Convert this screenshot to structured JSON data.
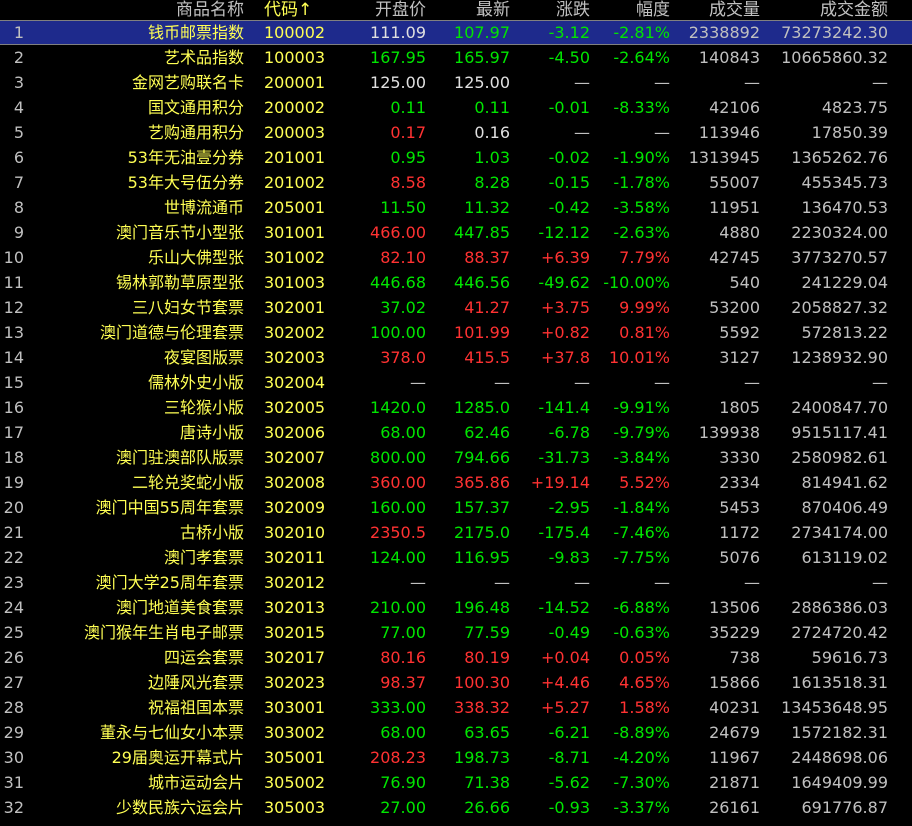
{
  "headers": {
    "name": "商品名称",
    "code": "代码",
    "sort_arrow": "↑",
    "open": "开盘价",
    "last": "最新",
    "change": "涨跌",
    "pct": "幅度",
    "volume": "成交量",
    "amount": "成交金额"
  },
  "colors": {
    "up": "#ff3232",
    "down": "#00e600",
    "label": "#ffff54",
    "text": "#c0c0c0",
    "selected_bg": "#1e2a8c"
  },
  "selected_row": 1,
  "rows": [
    {
      "idx": "1",
      "name": "钱币邮票指数",
      "code": "100002",
      "open": "111.09",
      "last": "107.97",
      "chg": "-3.12",
      "pct": "-2.81%",
      "vol": "2338892",
      "amt": "73273242.30",
      "open_c": "flat",
      "last_c": "down",
      "chg_c": "down"
    },
    {
      "idx": "2",
      "name": "艺术品指数",
      "code": "100003",
      "open": "167.95",
      "last": "165.97",
      "chg": "-4.50",
      "pct": "-2.64%",
      "vol": "140843",
      "amt": "10665860.32",
      "open_c": "down",
      "last_c": "down",
      "chg_c": "down"
    },
    {
      "idx": "3",
      "name": "金网艺购联名卡",
      "code": "200001",
      "open": "125.00",
      "last": "125.00",
      "chg": "—",
      "pct": "—",
      "vol": "—",
      "amt": "—",
      "open_c": "flat",
      "last_c": "flat",
      "chg_c": "dash"
    },
    {
      "idx": "4",
      "name": "国文通用积分",
      "code": "200002",
      "open": "0.11",
      "last": "0.11",
      "chg": "-0.01",
      "pct": "-8.33%",
      "vol": "42106",
      "amt": "4823.75",
      "open_c": "down",
      "last_c": "down",
      "chg_c": "down"
    },
    {
      "idx": "5",
      "name": "艺购通用积分",
      "code": "200003",
      "open": "0.17",
      "last": "0.16",
      "chg": "—",
      "pct": "—",
      "vol": "113946",
      "amt": "17850.39",
      "open_c": "up",
      "last_c": "flat",
      "chg_c": "dash"
    },
    {
      "idx": "6",
      "name": "53年无油壹分券",
      "code": "201001",
      "open": "0.95",
      "last": "1.03",
      "chg": "-0.02",
      "pct": "-1.90%",
      "vol": "1313945",
      "amt": "1365262.76",
      "open_c": "down",
      "last_c": "down",
      "chg_c": "down"
    },
    {
      "idx": "7",
      "name": "53年大号伍分券",
      "code": "201002",
      "open": "8.58",
      "last": "8.28",
      "chg": "-0.15",
      "pct": "-1.78%",
      "vol": "55007",
      "amt": "455345.73",
      "open_c": "up",
      "last_c": "down",
      "chg_c": "down"
    },
    {
      "idx": "8",
      "name": "世博流通币",
      "code": "205001",
      "open": "11.50",
      "last": "11.32",
      "chg": "-0.42",
      "pct": "-3.58%",
      "vol": "11951",
      "amt": "136470.53",
      "open_c": "down",
      "last_c": "down",
      "chg_c": "down"
    },
    {
      "idx": "9",
      "name": "澳门音乐节小型张",
      "code": "301001",
      "open": "466.00",
      "last": "447.85",
      "chg": "-12.12",
      "pct": "-2.63%",
      "vol": "4880",
      "amt": "2230324.00",
      "open_c": "up",
      "last_c": "down",
      "chg_c": "down"
    },
    {
      "idx": "10",
      "name": "乐山大佛型张",
      "code": "301002",
      "open": "82.10",
      "last": "88.37",
      "chg": "+6.39",
      "pct": "7.79%",
      "vol": "42745",
      "amt": "3773270.57",
      "open_c": "up",
      "last_c": "up",
      "chg_c": "up"
    },
    {
      "idx": "11",
      "name": "锡林郭勒草原型张",
      "code": "301003",
      "open": "446.68",
      "last": "446.56",
      "chg": "-49.62",
      "pct": "-10.00%",
      "vol": "540",
      "amt": "241229.04",
      "open_c": "down",
      "last_c": "down",
      "chg_c": "down"
    },
    {
      "idx": "12",
      "name": "三八妇女节套票",
      "code": "302001",
      "open": "37.02",
      "last": "41.27",
      "chg": "+3.75",
      "pct": "9.99%",
      "vol": "53200",
      "amt": "2058827.32",
      "open_c": "down",
      "last_c": "up",
      "chg_c": "up"
    },
    {
      "idx": "13",
      "name": "澳门道德与伦理套票",
      "code": "302002",
      "open": "100.00",
      "last": "101.99",
      "chg": "+0.82",
      "pct": "0.81%",
      "vol": "5592",
      "amt": "572813.22",
      "open_c": "down",
      "last_c": "up",
      "chg_c": "up"
    },
    {
      "idx": "14",
      "name": "夜宴图版票",
      "code": "302003",
      "open": "378.0",
      "last": "415.5",
      "chg": "+37.8",
      "pct": "10.01%",
      "vol": "3127",
      "amt": "1238932.90",
      "open_c": "up",
      "last_c": "up",
      "chg_c": "up"
    },
    {
      "idx": "15",
      "name": "儒林外史小版",
      "code": "302004",
      "open": "—",
      "last": "—",
      "chg": "—",
      "pct": "—",
      "vol": "—",
      "amt": "—",
      "open_c": "dash",
      "last_c": "dash",
      "chg_c": "dash"
    },
    {
      "idx": "16",
      "name": "三轮猴小版",
      "code": "302005",
      "open": "1420.0",
      "last": "1285.0",
      "chg": "-141.4",
      "pct": "-9.91%",
      "vol": "1805",
      "amt": "2400847.70",
      "open_c": "down",
      "last_c": "down",
      "chg_c": "down"
    },
    {
      "idx": "17",
      "name": "唐诗小版",
      "code": "302006",
      "open": "68.00",
      "last": "62.46",
      "chg": "-6.78",
      "pct": "-9.79%",
      "vol": "139938",
      "amt": "9515117.41",
      "open_c": "down",
      "last_c": "down",
      "chg_c": "down"
    },
    {
      "idx": "18",
      "name": "澳门驻澳部队版票",
      "code": "302007",
      "open": "800.00",
      "last": "794.66",
      "chg": "-31.73",
      "pct": "-3.84%",
      "vol": "3330",
      "amt": "2580982.61",
      "open_c": "down",
      "last_c": "down",
      "chg_c": "down"
    },
    {
      "idx": "19",
      "name": "二轮兑奖蛇小版",
      "code": "302008",
      "open": "360.00",
      "last": "365.86",
      "chg": "+19.14",
      "pct": "5.52%",
      "vol": "2334",
      "amt": "814941.62",
      "open_c": "up",
      "last_c": "up",
      "chg_c": "up"
    },
    {
      "idx": "20",
      "name": "澳门中国55周年套票",
      "code": "302009",
      "open": "160.00",
      "last": "157.37",
      "chg": "-2.95",
      "pct": "-1.84%",
      "vol": "5453",
      "amt": "870406.49",
      "open_c": "down",
      "last_c": "down",
      "chg_c": "down"
    },
    {
      "idx": "21",
      "name": "古桥小版",
      "code": "302010",
      "open": "2350.5",
      "last": "2175.0",
      "chg": "-175.4",
      "pct": "-7.46%",
      "vol": "1172",
      "amt": "2734174.00",
      "open_c": "up",
      "last_c": "down",
      "chg_c": "down"
    },
    {
      "idx": "22",
      "name": "澳门孝套票",
      "code": "302011",
      "open": "124.00",
      "last": "116.95",
      "chg": "-9.83",
      "pct": "-7.75%",
      "vol": "5076",
      "amt": "613119.02",
      "open_c": "down",
      "last_c": "down",
      "chg_c": "down"
    },
    {
      "idx": "23",
      "name": "澳门大学25周年套票",
      "code": "302012",
      "open": "—",
      "last": "—",
      "chg": "—",
      "pct": "—",
      "vol": "—",
      "amt": "—",
      "open_c": "dash",
      "last_c": "dash",
      "chg_c": "dash"
    },
    {
      "idx": "24",
      "name": "澳门地道美食套票",
      "code": "302013",
      "open": "210.00",
      "last": "196.48",
      "chg": "-14.52",
      "pct": "-6.88%",
      "vol": "13506",
      "amt": "2886386.03",
      "open_c": "down",
      "last_c": "down",
      "chg_c": "down"
    },
    {
      "idx": "25",
      "name": "澳门猴年生肖电子邮票",
      "code": "302015",
      "open": "77.00",
      "last": "77.59",
      "chg": "-0.49",
      "pct": "-0.63%",
      "vol": "35229",
      "amt": "2724720.42",
      "open_c": "down",
      "last_c": "down",
      "chg_c": "down"
    },
    {
      "idx": "26",
      "name": "四运会套票",
      "code": "302017",
      "open": "80.16",
      "last": "80.19",
      "chg": "+0.04",
      "pct": "0.05%",
      "vol": "738",
      "amt": "59616.73",
      "open_c": "up",
      "last_c": "up",
      "chg_c": "up"
    },
    {
      "idx": "27",
      "name": "边陲风光套票",
      "code": "302023",
      "open": "98.37",
      "last": "100.30",
      "chg": "+4.46",
      "pct": "4.65%",
      "vol": "15866",
      "amt": "1613518.31",
      "open_c": "up",
      "last_c": "up",
      "chg_c": "up"
    },
    {
      "idx": "28",
      "name": "祝福祖国本票",
      "code": "303001",
      "open": "333.00",
      "last": "338.32",
      "chg": "+5.27",
      "pct": "1.58%",
      "vol": "40231",
      "amt": "13453648.95",
      "open_c": "down",
      "last_c": "up",
      "chg_c": "up"
    },
    {
      "idx": "29",
      "name": "董永与七仙女小本票",
      "code": "303002",
      "open": "68.00",
      "last": "63.65",
      "chg": "-6.21",
      "pct": "-8.89%",
      "vol": "24679",
      "amt": "1572182.31",
      "open_c": "down",
      "last_c": "down",
      "chg_c": "down"
    },
    {
      "idx": "30",
      "name": "29届奥运开幕式片",
      "code": "305001",
      "open": "208.23",
      "last": "198.73",
      "chg": "-8.71",
      "pct": "-4.20%",
      "vol": "11967",
      "amt": "2448698.06",
      "open_c": "up",
      "last_c": "down",
      "chg_c": "down"
    },
    {
      "idx": "31",
      "name": "城市运动会片",
      "code": "305002",
      "open": "76.90",
      "last": "71.38",
      "chg": "-5.62",
      "pct": "-7.30%",
      "vol": "21871",
      "amt": "1649409.99",
      "open_c": "down",
      "last_c": "down",
      "chg_c": "down"
    },
    {
      "idx": "32",
      "name": "少数民族六运会片",
      "code": "305003",
      "open": "27.00",
      "last": "26.66",
      "chg": "-0.93",
      "pct": "-3.37%",
      "vol": "26161",
      "amt": "691776.87",
      "open_c": "down",
      "last_c": "down",
      "chg_c": "down"
    }
  ]
}
